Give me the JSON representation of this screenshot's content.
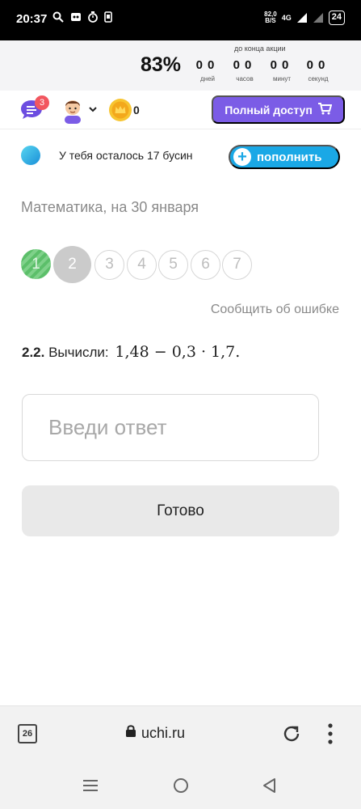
{
  "status_bar": {
    "time": "20:37",
    "speed_value": "82,0",
    "speed_unit": "B/S",
    "network": "4G",
    "battery": "24"
  },
  "promo": {
    "caption": "до конца акции",
    "discount": "83%",
    "countdown": [
      {
        "value": "00",
        "label": "дней"
      },
      {
        "value": "00",
        "label": "часов"
      },
      {
        "value": "00",
        "label": "минут"
      },
      {
        "value": "00",
        "label": "секунд"
      }
    ]
  },
  "nav": {
    "chat_badge": "3",
    "coins": "0",
    "full_access_label": "Полный доступ"
  },
  "beads": {
    "text": "У тебя осталось 17 бусин",
    "topup_label": "пополнить"
  },
  "lesson": {
    "title": "Математика, на 30 января",
    "steps": [
      {
        "label": "1",
        "state": "done"
      },
      {
        "label": "2",
        "state": "active"
      },
      {
        "label": "3",
        "state": "future"
      },
      {
        "label": "4",
        "state": "future"
      },
      {
        "label": "5",
        "state": "future"
      },
      {
        "label": "6",
        "state": "future"
      },
      {
        "label": "7",
        "state": "future"
      }
    ],
    "report_label": "Сообщить об ошибке"
  },
  "question": {
    "number": "2.2.",
    "prompt": "Вычисли:",
    "expression": "1,48 − 0,3 · 1,7."
  },
  "answer": {
    "placeholder": "Введи ответ",
    "value": ""
  },
  "submit_label": "Готово",
  "browser": {
    "tabs_count": "26",
    "url": "uchi.ru"
  },
  "colors": {
    "brand_purple": "#7b5ce6",
    "topup_blue": "#1aa8e6",
    "badge_red": "#f2565f",
    "step_done_green": "#5cbf6a"
  }
}
